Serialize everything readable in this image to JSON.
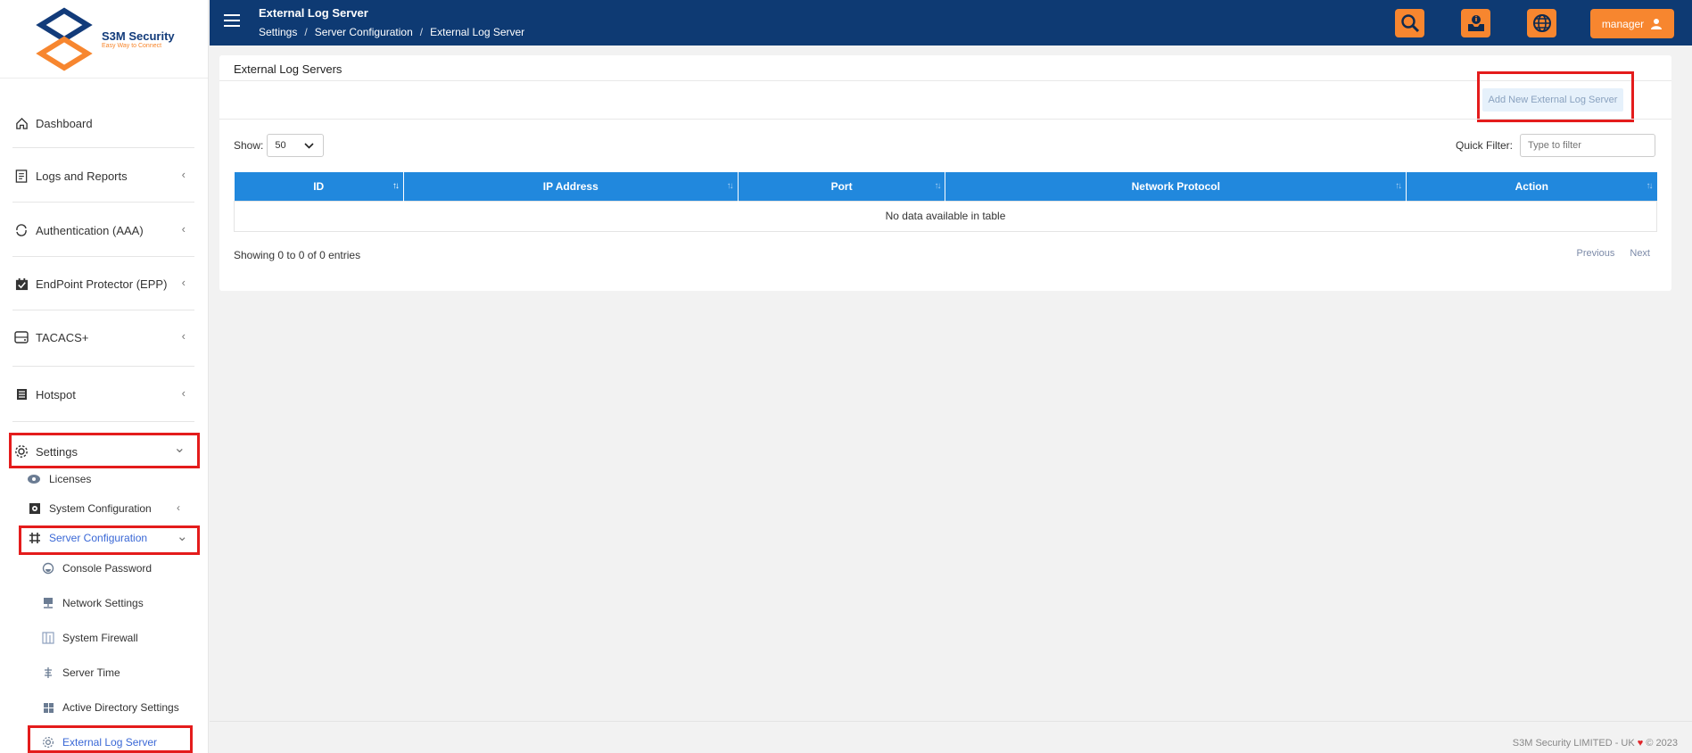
{
  "brand": {
    "name": "S3M Security",
    "tagline": "Easy Way to Connect"
  },
  "header": {
    "title": "External Log Server",
    "breadcrumb": [
      "Settings",
      "Server Configuration",
      "External Log Server"
    ],
    "user_label": "manager"
  },
  "sidebar": {
    "items": [
      {
        "label": "Dashboard",
        "icon": "home-icon",
        "chevron": ""
      },
      {
        "label": "Logs and Reports",
        "icon": "report-icon",
        "chevron": "‹"
      },
      {
        "label": "Authentication (AAA)",
        "icon": "sync-icon",
        "chevron": "‹"
      },
      {
        "label": "EndPoint Protector (EPP)",
        "icon": "calendar-check-icon",
        "chevron": "‹"
      },
      {
        "label": "TACACS+",
        "icon": "server-icon",
        "chevron": "‹"
      },
      {
        "label": "Hotspot",
        "icon": "list-icon",
        "chevron": "‹"
      },
      {
        "label": "Settings",
        "icon": "gear-icon",
        "chevron": "⌄"
      }
    ],
    "settings_sub": [
      {
        "label": "Licenses",
        "icon": "license-icon"
      },
      {
        "label": "System Configuration",
        "icon": "system-icon",
        "chevron": "‹"
      },
      {
        "label": "Server Configuration",
        "icon": "network-icon",
        "chevron": "⌄"
      }
    ],
    "server_sub": [
      {
        "label": "Console Password",
        "icon": "console-icon"
      },
      {
        "label": "Network Settings",
        "icon": "network-settings-icon"
      },
      {
        "label": "System Firewall",
        "icon": "firewall-icon"
      },
      {
        "label": "Server Time",
        "icon": "clock-icon"
      },
      {
        "label": "Active Directory Settings",
        "icon": "windows-icon"
      },
      {
        "label": "External Log Server",
        "icon": "gear-small-icon"
      }
    ]
  },
  "card": {
    "title": "External Log Servers",
    "add_button": "Add New External Log Server",
    "show_label": "Show:",
    "show_value": "50",
    "filter_label": "Quick Filter:",
    "filter_placeholder": "Type to filter",
    "columns": [
      "ID",
      "IP Address",
      "Port",
      "Network Protocol",
      "Action"
    ],
    "empty_message": "No data available in table",
    "info": "Showing 0 to 0 of 0 entries",
    "prev": "Previous",
    "next": "Next"
  },
  "footer": {
    "text": "S3M Security LIMITED - UK",
    "year": "© 2023"
  },
  "colors": {
    "navy": "#0e3a73",
    "orange": "#f7862f",
    "table_header": "#2188dd",
    "highlight": "#e41c1c"
  }
}
